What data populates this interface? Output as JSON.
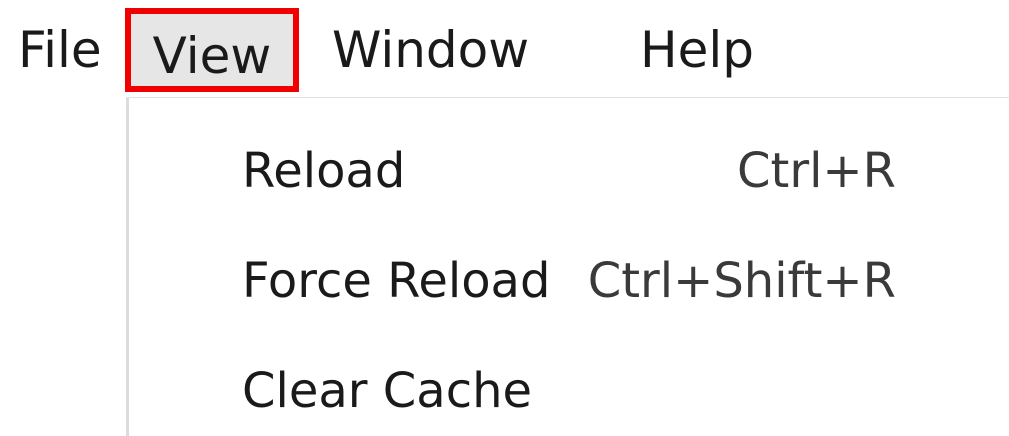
{
  "menubar": {
    "items": [
      {
        "label": "File"
      },
      {
        "label": "View",
        "state": "open",
        "highlight_color": "#f00000"
      },
      {
        "label": "Window"
      },
      {
        "label": "Help"
      }
    ]
  },
  "view_menu": {
    "items": [
      {
        "label": "Reload",
        "shortcut": "Ctrl+R"
      },
      {
        "label": "Force Reload",
        "shortcut": "Ctrl+Shift+R"
      },
      {
        "label": "Clear Cache",
        "shortcut": ""
      }
    ]
  }
}
